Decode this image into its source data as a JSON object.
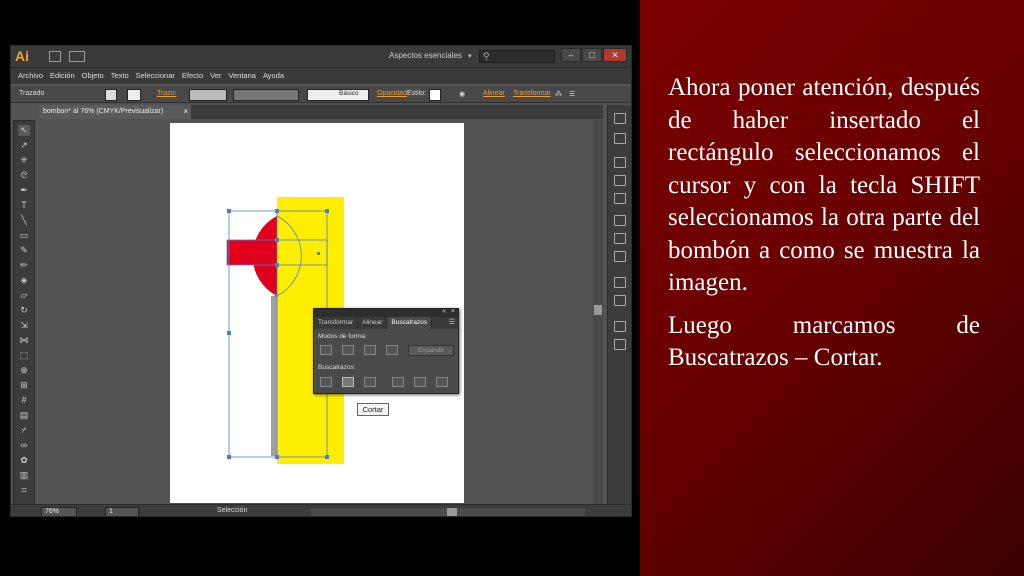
{
  "slide": {
    "paragraphs": [
      "Ahora poner atención, después de haber insertado el rectángulo seleccionamos el cursor y con la tecla SHIFT seleccionamos la otra parte del bombón a como se muestra la imagen.",
      "Luego marcamos de Buscatrazos – Cortar."
    ]
  },
  "app": {
    "logo": "Ai",
    "workspace": "Aspectos esenciales",
    "menu": [
      "Archivo",
      "Edición",
      "Objeto",
      "Texto",
      "Seleccionar",
      "Efecto",
      "Ver",
      "Ventana",
      "Ayuda"
    ],
    "control": {
      "mode": "Trazado",
      "stroke_label": "Trazo:",
      "stroke_style": "Básico",
      "opacity_label": "Opacidad",
      "style_label": "Estilo:",
      "align_label": "Alinear",
      "transform_label": "Transformar"
    },
    "document_tab": "bombon* al 76% (CMYK/Previsualizar)",
    "status": {
      "zoom": "76%",
      "page": "1",
      "tool": "Selección"
    },
    "pathfinder": {
      "tabs": [
        "Transformar",
        "Alinear",
        "Buscatrazos"
      ],
      "shape_modes_label": "Modos de forma:",
      "expand_label": "Expandir",
      "pathfinders_label": "Buscatrazos:"
    },
    "tooltip": "Cortar",
    "colors": {
      "accent": "#e8a33d",
      "red": "#e0001b",
      "yellow": "#ffee00",
      "selection": "#4a7fd0"
    }
  }
}
